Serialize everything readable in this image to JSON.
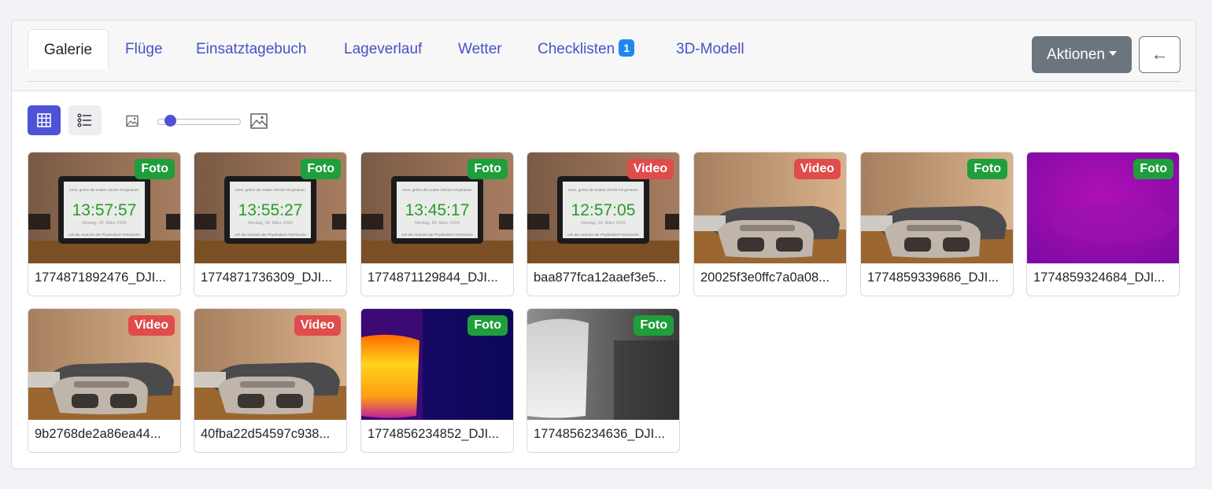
{
  "tabs": [
    {
      "label": "Galerie",
      "active": true
    },
    {
      "label": "Flüge"
    },
    {
      "label": "Einsatztagebuch"
    },
    {
      "label": "Lageverlauf"
    },
    {
      "label": "Wetter"
    },
    {
      "label": "Checklisten",
      "badge": "1"
    },
    {
      "label": "3D-Modell"
    }
  ],
  "toolbar": {
    "actions_label": "Aktionen",
    "back_label": "←",
    "active_view": "grid",
    "thumbnail_size_level": 0.1
  },
  "colors": {
    "accent": "#4d52d6",
    "foto_badge": "#1f9e3c",
    "video_badge": "#e04b4b",
    "link": "#4a50c7"
  },
  "gallery": [
    {
      "name": "1774871892476_DJI...",
      "type": "Foto",
      "time": "13:57:57",
      "thumb": "clock"
    },
    {
      "name": "1774871736309_DJI...",
      "type": "Foto",
      "time": "13:55:27",
      "thumb": "clock"
    },
    {
      "name": "1774871129844_DJI...",
      "type": "Foto",
      "time": "13:45:17",
      "thumb": "clock"
    },
    {
      "name": "baa877fca12aaef3e5...",
      "type": "Video",
      "time": "12:57:05",
      "thumb": "clock"
    },
    {
      "name": "20025f3e0ffc7a0a08...",
      "type": "Video",
      "thumb": "controller"
    },
    {
      "name": "1774859339686_DJI...",
      "type": "Foto",
      "thumb": "controller"
    },
    {
      "name": "1774859324684_DJI...",
      "type": "Foto",
      "thumb": "magenta"
    },
    {
      "name": "9b2768de2a86ea44...",
      "type": "Video",
      "thumb": "controller"
    },
    {
      "name": "40fba22d54597c938...",
      "type": "Video",
      "thumb": "controller"
    },
    {
      "name": "1774856234852_DJI...",
      "type": "Foto",
      "thumb": "thermal"
    },
    {
      "name": "1774856234636_DJI...",
      "type": "Foto",
      "thumb": "gray"
    }
  ]
}
